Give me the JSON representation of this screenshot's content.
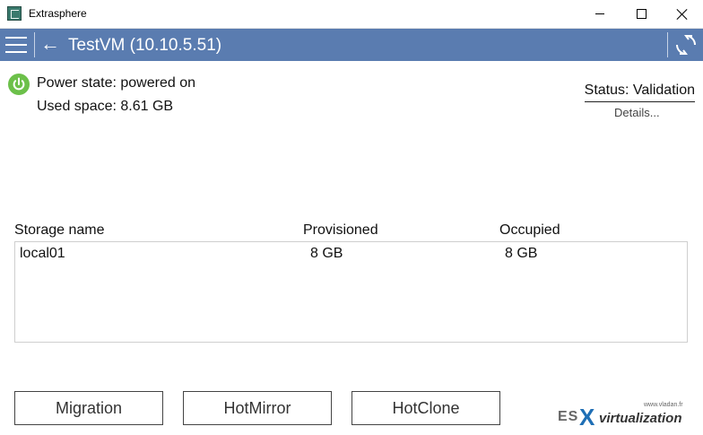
{
  "window": {
    "title": "Extrasphere",
    "controls": {
      "minimize": "minimize-icon",
      "maximize": "maximize-icon",
      "close": "close-icon"
    }
  },
  "appbar": {
    "menu_icon": "hamburger-menu-icon",
    "back_icon": "back-arrow-icon",
    "title": "TestVM (10.10.5.51)",
    "refresh_icon": "refresh-icon",
    "background": "#5a7cb0"
  },
  "vm_info": {
    "power_icon": "power-icon",
    "power_icon_color": "#6cc04a",
    "power_state": "Power state: powered on",
    "used_space": "Used space: 8.61 GB"
  },
  "status": {
    "label": "Status: Validation",
    "details_link": "Details..."
  },
  "storage": {
    "columns": [
      "Storage name",
      "Provisioned",
      "Occupied"
    ],
    "rows": [
      {
        "name": "local01",
        "provisioned": "8 GB",
        "occupied": "8 GB"
      }
    ]
  },
  "actions": {
    "migration": "Migration",
    "hotmirror": "HotMirror",
    "hotclone": "HotClone"
  },
  "watermark": {
    "url": "www.vladan.fr",
    "es": "ES",
    "x": "X",
    "virtualization": "virtualization",
    "accent": "#1f6fb5"
  }
}
